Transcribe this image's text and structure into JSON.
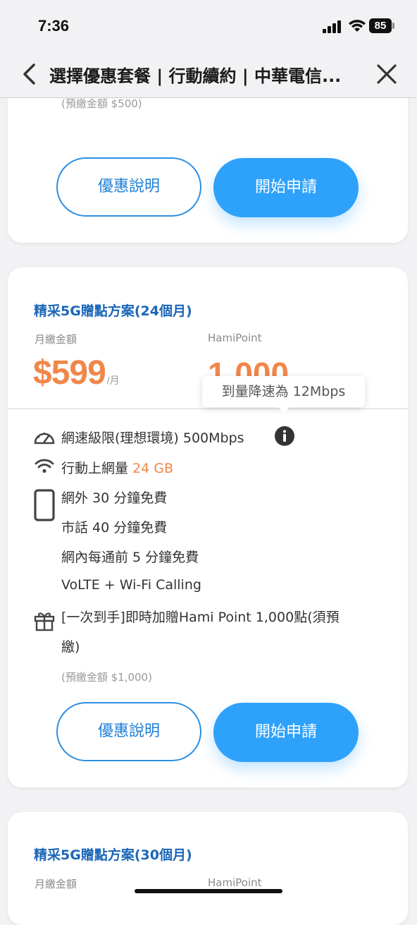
{
  "status_bar": {
    "time": "7:36",
    "battery": "85"
  },
  "nav": {
    "title": "選擇優惠套餐 | 行動續約 | 中華電信..."
  },
  "top_card": {
    "prepaid_note": "(預繳金額 $500)",
    "info_button": "優惠說明",
    "apply_button": "開始申請"
  },
  "plan_24": {
    "title": "精采5G贈點方案(24個月)",
    "monthly_label": "月繳金額",
    "points_label": "HamiPoint",
    "price": "$599",
    "price_unit": "/月",
    "points": "1,000",
    "tooltip": "到量降速為 12Mbps",
    "features": {
      "speed": "網速級限(理想環境) 500Mbps",
      "data_prefix": "行動上網量 ",
      "data_value": "24 GB",
      "offnet_calls": "網外 30 分鐘免費",
      "landline_calls": "市話 40 分鐘免費",
      "onnet_calls": "網內每通前 5 分鐘免費",
      "volte": "VoLTE + Wi-Fi Calling",
      "gift_line1": "[一次到手]即時加贈Hami Point 1,000點(須預",
      "gift_line2": "繳)"
    },
    "prepaid_note": "(預繳金額 $1,000)",
    "info_button": "優惠說明",
    "apply_button": "開始申請"
  },
  "plan_30": {
    "title": "精采5G贈點方案(30個月)",
    "monthly_label": "月繳金額",
    "points_label": "HamiPoint"
  },
  "icons": {
    "back": "chevron-left-icon",
    "close": "close-icon",
    "speed": "speedometer-icon",
    "data": "wifi-icon",
    "phone": "phone-icon",
    "gift": "gift-icon",
    "info": "info-icon"
  },
  "colors": {
    "accent_blue": "#2ea2fb",
    "title_blue": "#1b66b8",
    "price_orange": "#f0874a"
  }
}
